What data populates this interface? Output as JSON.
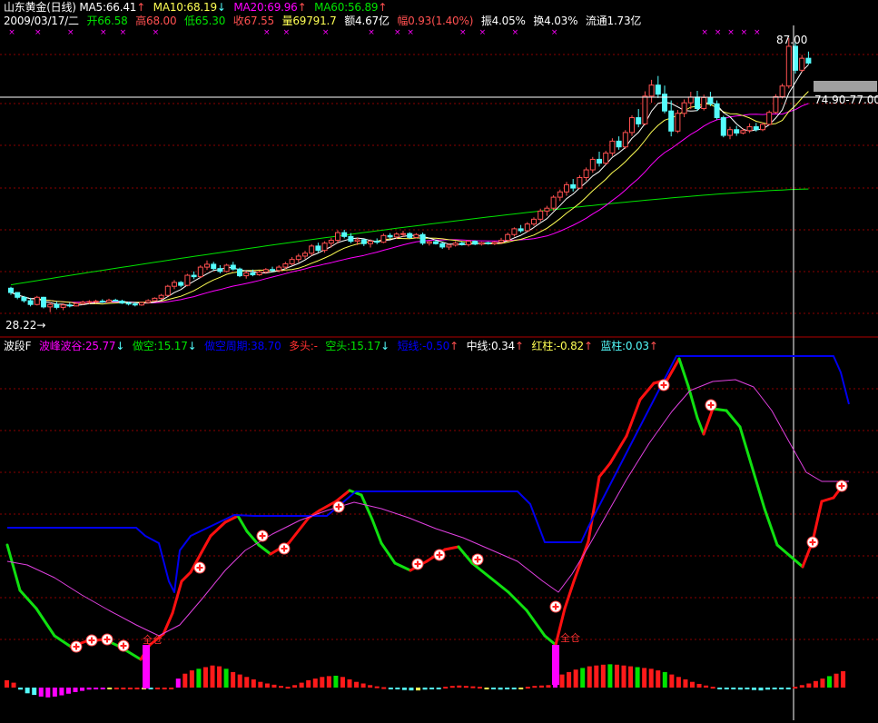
{
  "colors": {
    "up": "#ff5050",
    "down": "#54fcfc",
    "ma5": "#ffffff",
    "ma10": "#ffff54",
    "ma20": "#ff00ff",
    "ma60": "#00e400",
    "divider": "#b00000",
    "grid": "#8b0000"
  },
  "header": {
    "title": "山东黄金(日线)",
    "ma5": "MA5:66.41",
    "ma5_arrow": "↑",
    "ma10": "MA10:68.19",
    "ma10_arrow": "↓",
    "ma20": "MA20:69.96",
    "ma20_arrow": "↑",
    "ma60": "MA60:56.89",
    "ma60_arrow": "↑"
  },
  "quote": {
    "date": "2009/03/17/二",
    "open": "开66.58",
    "high": "高68.00",
    "low": "低65.30",
    "close": "收67.55",
    "volume": "量69791.7",
    "amount": "额4.67亿",
    "change": "幅0.93(1.40%)",
    "amplitude": "振4.05%",
    "turnover": "换4.03%",
    "float": "流通1.73亿"
  },
  "price_axis": {
    "high_label": "87.00",
    "low_label": "28.22",
    "low_arrow": "→",
    "crosshair_label": "74.90-77.00"
  },
  "indicator_header": {
    "name": "波段F",
    "wave": "波峰波谷:25.77",
    "wave_arrow": "↓",
    "short": "做空:15.17",
    "short_arrow": "↓",
    "short_cycle": "做空周期:38.70",
    "bull": "多头:-",
    "bear": "空头:15.17",
    "bear_arrow": "↓",
    "short_line": "短线:-0.50",
    "short_line_arrow": "↑",
    "mid_line": "中线:0.34",
    "mid_line_arrow": "↑",
    "red_bar": "红柱:-0.82",
    "red_bar_arrow": "↑",
    "blue_bar": "蓝柱:0.03",
    "blue_bar_arrow": "↑"
  },
  "signals": {
    "full_position_label": "全仓"
  },
  "chart_data": [
    {
      "type": "candlestick",
      "title": "山东黄金(日线)",
      "ylim": [
        28.22,
        87.0
      ],
      "ohlc": [
        [
          34.8,
          35.1,
          33.4,
          33.9
        ],
        [
          33.9,
          34.0,
          32.5,
          32.9
        ],
        [
          32.9,
          33.2,
          31.8,
          32.2
        ],
        [
          32.2,
          32.8,
          31.0,
          31.4
        ],
        [
          31.4,
          33.2,
          31.2,
          32.9
        ],
        [
          32.9,
          33.0,
          30.6,
          30.9
        ],
        [
          30.9,
          31.8,
          29.8,
          31.4
        ],
        [
          31.4,
          32.0,
          30.4,
          30.8
        ],
        [
          30.8,
          31.6,
          30.2,
          31.3
        ],
        [
          31.3,
          31.8,
          30.8,
          31.1
        ],
        [
          31.1,
          31.9,
          31.0,
          31.6
        ],
        [
          31.6,
          32.2,
          31.3,
          31.9
        ],
        [
          31.9,
          32.3,
          31.5,
          32.0
        ],
        [
          32.0,
          32.4,
          31.6,
          32.1
        ],
        [
          32.1,
          32.5,
          31.7,
          31.9
        ],
        [
          31.9,
          32.6,
          31.8,
          32.3
        ],
        [
          32.3,
          32.6,
          32.0,
          32.1
        ],
        [
          32.1,
          32.4,
          31.5,
          31.7
        ],
        [
          31.7,
          32.0,
          31.2,
          31.5
        ],
        [
          31.5,
          31.9,
          31.0,
          31.3
        ],
        [
          31.3,
          32.0,
          31.1,
          31.8
        ],
        [
          31.8,
          32.5,
          31.6,
          32.2
        ],
        [
          32.2,
          32.9,
          32.0,
          32.7
        ],
        [
          32.7,
          33.6,
          32.4,
          33.3
        ],
        [
          33.3,
          35.5,
          33.1,
          35.2
        ],
        [
          35.2,
          36.5,
          34.6,
          36.0
        ],
        [
          36.0,
          36.3,
          35.0,
          35.4
        ],
        [
          35.4,
          37.8,
          35.2,
          37.5
        ],
        [
          37.5,
          38.3,
          36.7,
          37.2
        ],
        [
          37.2,
          39.6,
          36.9,
          39.2
        ],
        [
          39.2,
          40.6,
          38.6,
          39.8
        ],
        [
          39.8,
          40.3,
          38.4,
          38.9
        ],
        [
          38.9,
          39.6,
          37.9,
          38.3
        ],
        [
          38.3,
          39.9,
          38.1,
          39.6
        ],
        [
          39.6,
          40.3,
          38.5,
          38.8
        ],
        [
          38.8,
          39.1,
          37.1,
          37.4
        ],
        [
          37.4,
          38.3,
          36.8,
          38.0
        ],
        [
          38.0,
          38.7,
          37.3,
          37.6
        ],
        [
          37.6,
          38.5,
          37.4,
          38.2
        ],
        [
          38.2,
          39.0,
          37.8,
          38.7
        ],
        [
          38.7,
          39.3,
          38.2,
          38.5
        ],
        [
          38.5,
          39.6,
          38.1,
          39.2
        ],
        [
          39.2,
          40.3,
          38.8,
          39.9
        ],
        [
          39.9,
          41.3,
          39.6,
          40.8
        ],
        [
          40.8,
          42.0,
          40.2,
          41.5
        ],
        [
          41.5,
          42.6,
          40.9,
          42.1
        ],
        [
          42.1,
          44.0,
          41.6,
          43.6
        ],
        [
          43.6,
          44.3,
          42.3,
          42.7
        ],
        [
          42.7,
          44.6,
          42.2,
          44.2
        ],
        [
          44.2,
          45.3,
          43.3,
          44.8
        ],
        [
          44.8,
          46.9,
          44.1,
          46.4
        ],
        [
          46.4,
          47.0,
          45.2,
          45.6
        ],
        [
          45.6,
          46.3,
          44.2,
          44.6
        ],
        [
          44.6,
          45.4,
          43.8,
          44.9
        ],
        [
          44.9,
          45.1,
          43.6,
          44.1
        ],
        [
          44.1,
          45.0,
          43.3,
          44.6
        ],
        [
          44.6,
          45.2,
          44.0,
          44.4
        ],
        [
          44.4,
          46.2,
          44.2,
          45.8
        ],
        [
          45.8,
          46.3,
          45.1,
          45.5
        ],
        [
          45.5,
          46.5,
          45.1,
          46.1
        ],
        [
          46.1,
          46.8,
          45.5,
          46.2
        ],
        [
          46.2,
          46.5,
          45.1,
          45.4
        ],
        [
          45.4,
          46.3,
          45.2,
          46.0
        ],
        [
          46.0,
          46.4,
          43.8,
          44.2
        ],
        [
          44.2,
          44.7,
          43.7,
          44.5
        ],
        [
          44.5,
          44.8,
          43.9,
          44.1
        ],
        [
          44.1,
          44.4,
          43.0,
          43.4
        ],
        [
          43.4,
          44.1,
          42.8,
          43.8
        ],
        [
          43.8,
          44.6,
          43.5,
          44.2
        ],
        [
          44.2,
          44.5,
          43.7,
          43.9
        ],
        [
          43.9,
          44.9,
          43.5,
          44.6
        ],
        [
          44.6,
          44.8,
          43.8,
          44.0
        ],
        [
          44.0,
          44.5,
          43.7,
          44.3
        ],
        [
          44.3,
          44.5,
          43.9,
          44.1
        ],
        [
          44.1,
          44.6,
          43.8,
          44.4
        ],
        [
          44.4,
          45.3,
          44.0,
          44.8
        ],
        [
          44.8,
          46.4,
          44.5,
          46.0
        ],
        [
          46.0,
          47.5,
          45.6,
          47.2
        ],
        [
          47.2,
          48.0,
          46.4,
          46.8
        ],
        [
          46.8,
          48.6,
          46.5,
          48.2
        ],
        [
          48.2,
          49.6,
          47.8,
          49.2
        ],
        [
          49.2,
          51.4,
          48.7,
          50.9
        ],
        [
          50.9,
          52.0,
          49.9,
          51.5
        ],
        [
          51.5,
          54.2,
          51.0,
          53.8
        ],
        [
          53.8,
          55.4,
          53.0,
          54.9
        ],
        [
          54.9,
          57.0,
          54.1,
          56.4
        ],
        [
          56.4,
          57.6,
          55.0,
          55.7
        ],
        [
          55.7,
          58.4,
          55.5,
          57.9
        ],
        [
          57.9,
          60.0,
          57.2,
          59.5
        ],
        [
          59.5,
          62.2,
          58.9,
          61.7
        ],
        [
          61.7,
          63.3,
          60.2,
          60.9
        ],
        [
          60.9,
          63.5,
          60.5,
          63.0
        ],
        [
          63.0,
          66.1,
          62.4,
          65.5
        ],
        [
          65.5,
          66.5,
          63.7,
          64.3
        ],
        [
          64.3,
          67.8,
          63.9,
          67.3
        ],
        [
          67.3,
          70.9,
          66.6,
          70.4
        ],
        [
          70.4,
          72.2,
          68.4,
          69.1
        ],
        [
          69.1,
          75.9,
          68.8,
          74.9
        ],
        [
          74.9,
          78.3,
          73.5,
          77.2
        ],
        [
          77.2,
          79.1,
          74.5,
          75.3
        ],
        [
          75.3,
          77.1,
          71.3,
          71.8
        ],
        [
          71.8,
          74.0,
          66.5,
          67.6
        ],
        [
          67.6,
          72.0,
          67.2,
          71.3
        ],
        [
          71.3,
          74.2,
          70.5,
          73.5
        ],
        [
          73.5,
          75.8,
          72.2,
          74.7
        ],
        [
          74.7,
          76.0,
          71.8,
          72.3
        ],
        [
          72.3,
          75.2,
          71.9,
          74.6
        ],
        [
          74.6,
          75.8,
          72.8,
          73.3
        ],
        [
          73.3,
          74.0,
          70.0,
          70.4
        ],
        [
          70.4,
          70.8,
          66.3,
          66.7
        ],
        [
          66.7,
          68.5,
          65.9,
          67.9
        ],
        [
          67.9,
          68.7,
          66.6,
          67.2
        ],
        [
          67.2,
          68.2,
          66.9,
          67.7
        ],
        [
          67.7,
          69.2,
          67.2,
          68.5
        ],
        [
          68.5,
          69.3,
          67.5,
          67.9
        ],
        [
          67.9,
          69.4,
          67.6,
          69.0
        ],
        [
          69.0,
          71.9,
          68.8,
          71.5
        ],
        [
          71.5,
          75.3,
          71.2,
          74.8
        ],
        [
          74.8,
          77.5,
          74.4,
          77.0
        ],
        [
          77.0,
          87.0,
          76.5,
          85.3
        ],
        [
          85.3,
          86.0,
          79.6,
          80.3
        ],
        [
          80.3,
          83.5,
          79.9,
          82.8
        ],
        [
          82.8,
          84.2,
          81.5,
          81.8
        ]
      ]
    },
    {
      "type": "bar",
      "title": "波段F",
      "ylim": [
        -0.8,
        1.0
      ],
      "values": [
        0.18,
        0.12,
        -0.05,
        -0.14,
        -0.18,
        -0.22,
        -0.24,
        -0.22,
        -0.19,
        -0.15,
        -0.11,
        -0.08,
        -0.05,
        -0.03,
        -0.02,
        -0.01,
        0.0,
        0.0,
        0.0,
        0.0,
        -0.02,
        -0.03,
        0.0,
        0.0,
        0.0,
        0.22,
        0.34,
        0.42,
        0.46,
        0.5,
        0.54,
        0.52,
        0.46,
        0.38,
        0.32,
        0.26,
        0.2,
        0.14,
        0.1,
        0.07,
        0.04,
        0.02,
        0.06,
        0.12,
        0.18,
        0.22,
        0.26,
        0.28,
        0.29,
        0.26,
        0.2,
        0.14,
        0.1,
        0.06,
        0.03,
        0.01,
        -0.02,
        -0.04,
        -0.06,
        -0.07,
        -0.07,
        -0.05,
        -0.03,
        -0.02,
        0.02,
        0.04,
        0.05,
        0.04,
        0.03,
        0.02,
        -0.02,
        -0.04,
        -0.05,
        -0.04,
        -0.03,
        -0.02,
        0.02,
        0.04,
        0.05,
        0.06,
        0.24,
        0.32,
        0.38,
        0.44,
        0.48,
        0.52,
        0.54,
        0.56,
        0.57,
        0.56,
        0.54,
        0.52,
        0.5,
        0.48,
        0.46,
        0.42,
        0.38,
        0.32,
        0.26,
        0.2,
        0.14,
        0.09,
        0.05,
        0.02,
        -0.01,
        -0.03,
        -0.04,
        -0.05,
        -0.04,
        -0.06,
        -0.07,
        -0.05,
        -0.03,
        -0.02,
        0.0,
        0.02,
        0.06,
        0.1,
        0.16,
        0.22,
        0.28,
        0.34,
        0.4
      ]
    }
  ]
}
